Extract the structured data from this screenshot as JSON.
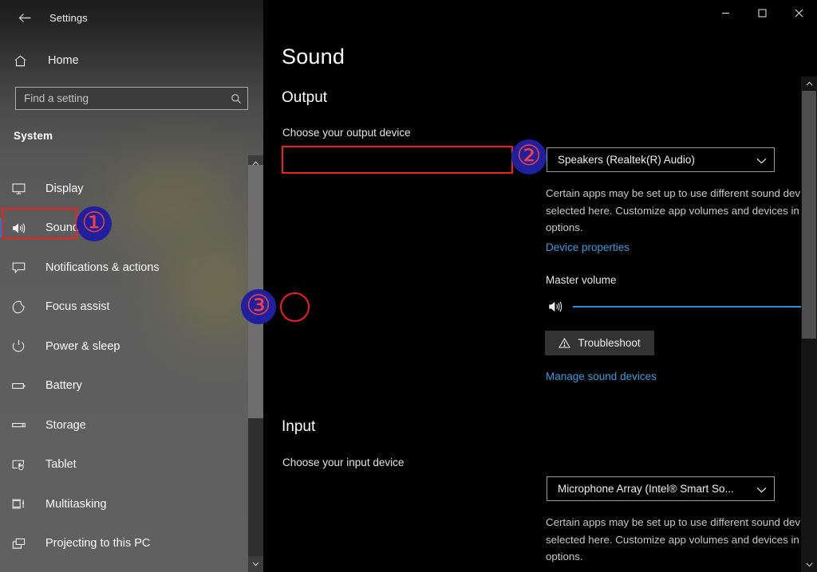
{
  "window": {
    "title": "Settings",
    "back_icon": "back-arrow-icon",
    "minimize_label": "Minimize",
    "maximize_label": "Maximize",
    "close_label": "Close",
    "accent_color": "#0a84d8"
  },
  "sidebar": {
    "home_label": "Home",
    "home_icon": "home-icon",
    "search": {
      "placeholder": "Find a setting",
      "value": "",
      "icon": "search-icon"
    },
    "group_label": "System",
    "items": [
      {
        "label": "Display",
        "icon": "monitor-icon",
        "selected": false
      },
      {
        "label": "Sound",
        "icon": "speaker-icon",
        "selected": true
      },
      {
        "label": "Notifications & actions",
        "icon": "callout-icon",
        "selected": false
      },
      {
        "label": "Focus assist",
        "icon": "moon-icon",
        "selected": false
      },
      {
        "label": "Power & sleep",
        "icon": "power-icon",
        "selected": false
      },
      {
        "label": "Battery",
        "icon": "battery-icon",
        "selected": false
      },
      {
        "label": "Storage",
        "icon": "drive-icon",
        "selected": false
      },
      {
        "label": "Tablet",
        "icon": "tablet-touch-icon",
        "selected": false
      },
      {
        "label": "Multitasking",
        "icon": "multitasking-icon",
        "selected": false
      },
      {
        "label": "Projecting to this PC",
        "icon": "projecting-icon",
        "selected": false
      }
    ],
    "scrollbar": {
      "up_icon": "chevron-up-icon",
      "down_icon": "chevron-down-icon"
    }
  },
  "main": {
    "page_title": "Sound",
    "output": {
      "heading": "Output",
      "choose_label": "Choose your output device",
      "selected_device": "Speakers (Realtek(R) Audio)",
      "chevron_icon": "chevron-down-icon",
      "description": "Certain apps may be set up to use different sound devices than the one selected here. Customize app volumes and devices in advanced sound options.",
      "device_properties_link": "Device properties",
      "master_volume_label": "Master volume",
      "volume_icon": "speaker-icon",
      "volume_value": "100",
      "volume_percent": 100,
      "troubleshoot_label": "Troubleshoot",
      "troubleshoot_icon": "warning-triangle-icon",
      "manage_link": "Manage sound devices"
    },
    "input": {
      "heading": "Input",
      "choose_label": "Choose your input device",
      "selected_device": "Microphone Array (Intel® Smart So...",
      "chevron_icon": "chevron-down-icon",
      "description": "Certain apps may be set up to use different sound devices than the one selected here. Customize app volumes and devices in advanced sound options."
    },
    "scrollbar": {
      "up_icon": "chevron-up-icon",
      "down_icon": "chevron-down-icon"
    }
  },
  "annotations": {
    "badge_color": "#201f9e",
    "number_color": "#f8413f",
    "outline_color": "#f02020",
    "badges": [
      {
        "glyph": "①",
        "target": "sidebar-item-sound"
      },
      {
        "glyph": "②",
        "target": "output-device-combo"
      },
      {
        "glyph": "③",
        "target": "master-volume-icon"
      }
    ]
  }
}
